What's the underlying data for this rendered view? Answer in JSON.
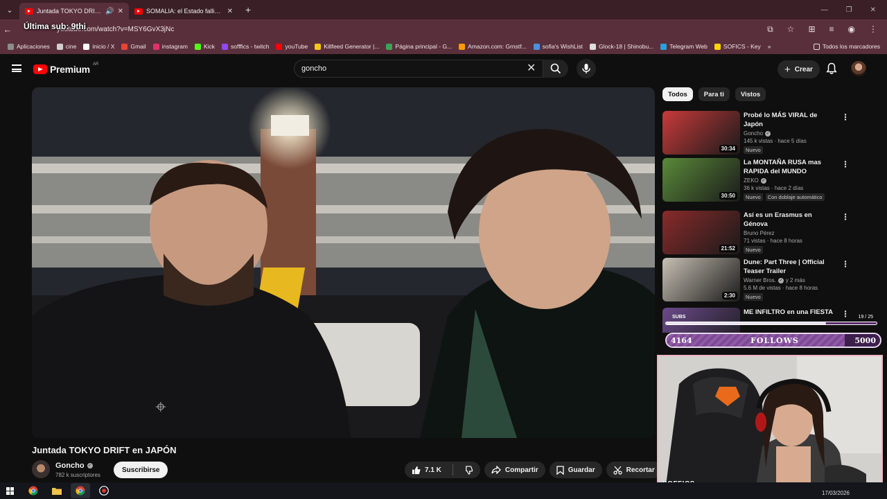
{
  "browser": {
    "tabs": [
      {
        "title": "Juntada TOKYO DRIFT en JAPÓN",
        "active": true
      },
      {
        "title": "SOMALIA: el Estado fallido más",
        "active": false
      }
    ],
    "url": "youtube.com/watch?v=MSY6GvX3jNc",
    "overlay_sub": "Última sub: 9thi",
    "bookmarks": [
      {
        "label": "Aplicaciones",
        "color": "#8c8c8c"
      },
      {
        "label": "cine",
        "color": "#cfcfcf"
      },
      {
        "label": "inicio / X",
        "color": "#ffffff"
      },
      {
        "label": "Gmail",
        "color": "#ea4335"
      },
      {
        "label": "instagram",
        "color": "#e1306c"
      },
      {
        "label": "Kick",
        "color": "#53fc18"
      },
      {
        "label": "sofffics - twitch",
        "color": "#9146ff"
      },
      {
        "label": "youTube",
        "color": "#ff0000"
      },
      {
        "label": "Killfeed Generator |...",
        "color": "#f5c518"
      },
      {
        "label": "Página principal - G...",
        "color": "#34a853"
      },
      {
        "label": "Amazon.com: Grnstf...",
        "color": "#ff9900"
      },
      {
        "label": "sofia's WishList",
        "color": "#4a90e2"
      },
      {
        "label": "Glock-18 | Shinobu...",
        "color": "#dddddd"
      },
      {
        "label": "Telegram Web",
        "color": "#2aa1da"
      },
      {
        "label": "SOFICS - Key",
        "color": "#ffd400"
      }
    ],
    "all_bookmarks": "Todos los marcadores"
  },
  "header": {
    "brand": "Premium",
    "country": "AR",
    "search_value": "goncho",
    "create_label": "Crear"
  },
  "video": {
    "title": "Juntada TOKYO DRIFT en JAPÓN",
    "channel": "Goncho",
    "subscribers": "782 k suscriptores",
    "subscribe_label": "Suscribirse",
    "likes": "7.1 K",
    "share_label": "Compartir",
    "save_label": "Guardar",
    "clip_label": "Recortar"
  },
  "chips": [
    "Todos",
    "Para ti",
    "Vistos"
  ],
  "recommendations": [
    {
      "title_lines": [
        "Probé lo MÁS VIRAL de Japón"
      ],
      "channel": "Goncho",
      "verified": true,
      "meta": "145 k vistas · hace 5 días",
      "badges": [
        "Nuevo"
      ],
      "duration": "30:34",
      "thumb": "#c93a3a"
    },
    {
      "title_lines": [
        "La MONTAÑA RUSA mas",
        "RAPIDA del MUNDO"
      ],
      "channel": "ZEKO",
      "verified": true,
      "meta": "36 k vistas · hace 2 días",
      "badges": [
        "Nuevo",
        "Con doblaje automático"
      ],
      "duration": "30:50",
      "thumb": "#5a8a3a"
    },
    {
      "title_lines": [
        "Así es un Erasmus en Génova"
      ],
      "channel": "Bruno Pérez",
      "verified": false,
      "meta": "71 vistas · hace 8 horas",
      "badges": [
        "Nuevo"
      ],
      "duration": "21:52",
      "thumb": "#8a2a2a"
    },
    {
      "title_lines": [
        "Dune: Part Three | Official",
        "Teaser Trailer"
      ],
      "channel": "Warner Bros.",
      "verified": true,
      "channel_extra": "y 2 más",
      "meta": "5.6 M de vistas · hace 8 horas",
      "badges": [
        "Nuevo"
      ],
      "duration": "2:30",
      "thumb": "#c8c0b4"
    },
    {
      "title_lines": [
        "ME INFILTRO en una FIESTA"
      ],
      "channel": "",
      "verified": false,
      "meta": "",
      "badges": [],
      "duration": "",
      "thumb": "#6a4a8a"
    }
  ],
  "stream_overlay": {
    "subs_label": "SUBS",
    "subs_count": "19 / 25",
    "subs_progress": 0.76,
    "follows_current": "4164",
    "follows_label": "FOLLOWS",
    "follows_goal": "5000",
    "follows_progress": 0.8328,
    "cam_tag": "SOFFICS"
  },
  "taskbar": {
    "date": "17/03/2026"
  }
}
